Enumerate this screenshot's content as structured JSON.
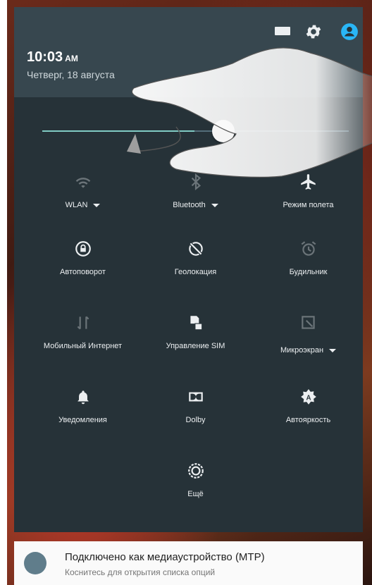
{
  "status": {
    "time": "10:03",
    "ampm": "AM",
    "date": "Четверг, 18 августа"
  },
  "brightness": {
    "level": 0.5
  },
  "tiles": [
    {
      "label": "WLAN",
      "icon": "wifi-icon",
      "dropdown": true,
      "active": false
    },
    {
      "label": "Bluetooth",
      "icon": "bluetooth-icon",
      "dropdown": true,
      "active": false
    },
    {
      "label": "Режим полета",
      "icon": "airplane-icon",
      "dropdown": false,
      "active": true
    },
    {
      "label": "Автоповорот",
      "icon": "auto-rotate-icon",
      "dropdown": false,
      "active": true
    },
    {
      "label": "Геолокация",
      "icon": "location-icon",
      "dropdown": false,
      "active": true
    },
    {
      "label": "Будильник",
      "icon": "alarm-icon",
      "dropdown": false,
      "active": false
    },
    {
      "label": "Мобильный Интернет",
      "icon": "mobile-data-icon",
      "dropdown": false,
      "active": false
    },
    {
      "label": "Управление SIM",
      "icon": "sim-management-icon",
      "dropdown": false,
      "active": true
    },
    {
      "label": "Микроэкран",
      "icon": "micro-screen-icon",
      "dropdown": true,
      "active": false
    },
    {
      "label": "Уведомления",
      "icon": "bell-icon",
      "dropdown": false,
      "active": true
    },
    {
      "label": "Dolby",
      "icon": "dolby-icon",
      "dropdown": false,
      "active": true
    },
    {
      "label": "Автояркость",
      "icon": "auto-brightness-icon",
      "dropdown": false,
      "active": true
    },
    {
      "label": "Ещё",
      "icon": "more-settings-icon",
      "dropdown": false,
      "active": true
    }
  ],
  "notification": {
    "title": "Подключено как медиаустройство (MTP)",
    "subtitle": "Коснитесь для открытия списка опций"
  },
  "colors": {
    "panel": "#263238",
    "header": "#37474f",
    "accent": "#80cbc4",
    "user_icon": "#29b6f6"
  }
}
